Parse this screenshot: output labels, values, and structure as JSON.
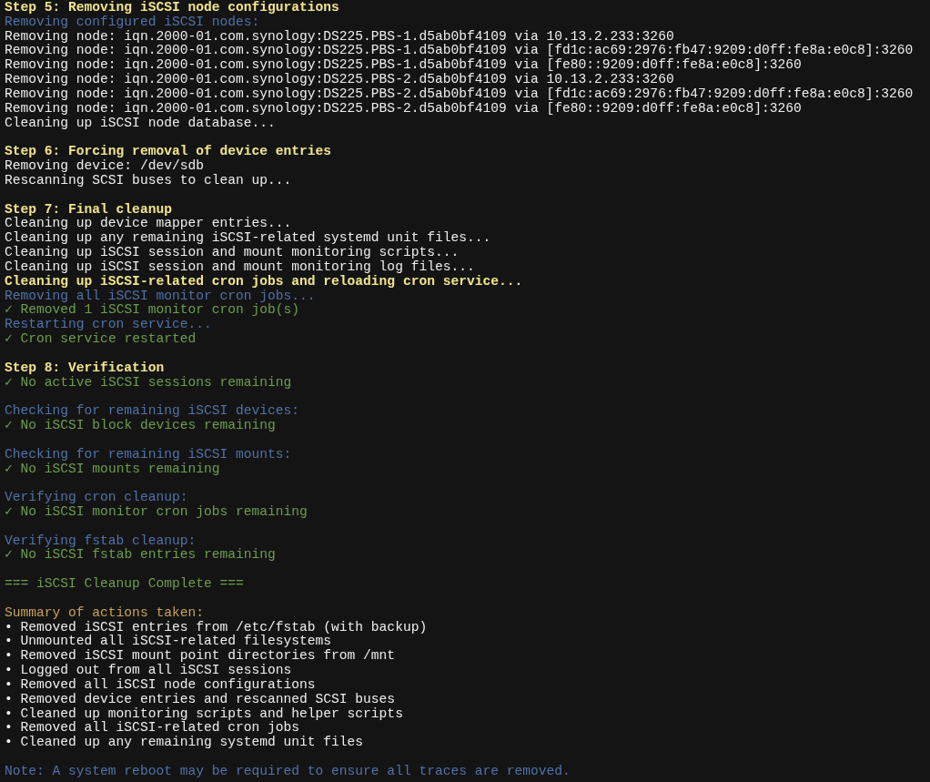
{
  "terminal": {
    "lines": [
      {
        "kind": "heading",
        "text": "Step 5: Removing iSCSI node configurations"
      },
      {
        "kind": "info",
        "text": "Removing configured iSCSI nodes:"
      },
      {
        "kind": "plain",
        "text": "Removing node: iqn.2000-01.com.synology:DS225.PBS-1.d5ab0bf4109 via 10.13.2.233:3260"
      },
      {
        "kind": "plain",
        "text": "Removing node: iqn.2000-01.com.synology:DS225.PBS-1.d5ab0bf4109 via [fd1c:ac69:2976:fb47:9209:d0ff:fe8a:e0c8]:3260"
      },
      {
        "kind": "plain",
        "text": "Removing node: iqn.2000-01.com.synology:DS225.PBS-1.d5ab0bf4109 via [fe80::9209:d0ff:fe8a:e0c8]:3260"
      },
      {
        "kind": "plain",
        "text": "Removing node: iqn.2000-01.com.synology:DS225.PBS-2.d5ab0bf4109 via 10.13.2.233:3260"
      },
      {
        "kind": "plain",
        "text": "Removing node: iqn.2000-01.com.synology:DS225.PBS-2.d5ab0bf4109 via [fd1c:ac69:2976:fb47:9209:d0ff:fe8a:e0c8]:3260"
      },
      {
        "kind": "plain",
        "text": "Removing node: iqn.2000-01.com.synology:DS225.PBS-2.d5ab0bf4109 via [fe80::9209:d0ff:fe8a:e0c8]:3260"
      },
      {
        "kind": "plain",
        "text": "Cleaning up iSCSI node database..."
      },
      {
        "kind": "blank"
      },
      {
        "kind": "heading",
        "text": "Step 6: Forcing removal of device entries"
      },
      {
        "kind": "plain",
        "text": "Removing device: /dev/sdb"
      },
      {
        "kind": "plain",
        "text": "Rescanning SCSI buses to clean up..."
      },
      {
        "kind": "blank"
      },
      {
        "kind": "heading",
        "text": "Step 7: Final cleanup"
      },
      {
        "kind": "plain",
        "text": "Cleaning up device mapper entries..."
      },
      {
        "kind": "plain",
        "text": "Cleaning up any remaining iSCSI-related systemd unit files..."
      },
      {
        "kind": "plain",
        "text": "Cleaning up iSCSI session and mount monitoring scripts..."
      },
      {
        "kind": "plain",
        "text": "Cleaning up iSCSI session and mount monitoring log files..."
      },
      {
        "kind": "heading",
        "text": "Cleaning up iSCSI-related cron jobs and reloading cron service..."
      },
      {
        "kind": "info",
        "text": "Removing all iSCSI monitor cron jobs..."
      },
      {
        "kind": "ok",
        "text": "✓ Removed 1 iSCSI monitor cron job(s)"
      },
      {
        "kind": "info",
        "text": "Restarting cron service..."
      },
      {
        "kind": "ok",
        "text": "✓ Cron service restarted"
      },
      {
        "kind": "blank"
      },
      {
        "kind": "heading",
        "text": "Step 8: Verification"
      },
      {
        "kind": "ok",
        "text": "✓ No active iSCSI sessions remaining"
      },
      {
        "kind": "blank"
      },
      {
        "kind": "info",
        "text": "Checking for remaining iSCSI devices:"
      },
      {
        "kind": "ok",
        "text": "✓ No iSCSI block devices remaining"
      },
      {
        "kind": "blank"
      },
      {
        "kind": "info",
        "text": "Checking for remaining iSCSI mounts:"
      },
      {
        "kind": "ok",
        "text": "✓ No iSCSI mounts remaining"
      },
      {
        "kind": "blank"
      },
      {
        "kind": "info",
        "text": "Verifying cron cleanup:"
      },
      {
        "kind": "ok",
        "text": "✓ No iSCSI monitor cron jobs remaining"
      },
      {
        "kind": "blank"
      },
      {
        "kind": "info",
        "text": "Verifying fstab cleanup:"
      },
      {
        "kind": "ok",
        "text": "✓ No iSCSI fstab entries remaining"
      },
      {
        "kind": "blank"
      },
      {
        "kind": "ok",
        "text": "=== iSCSI Cleanup Complete ==="
      },
      {
        "kind": "blank"
      },
      {
        "kind": "summary",
        "text": "Summary of actions taken:"
      },
      {
        "kind": "plain",
        "text": "• Removed iSCSI entries from /etc/fstab (with backup)"
      },
      {
        "kind": "plain",
        "text": "• Unmounted all iSCSI-related filesystems"
      },
      {
        "kind": "plain",
        "text": "• Removed iSCSI mount point directories from /mnt"
      },
      {
        "kind": "plain",
        "text": "• Logged out from all iSCSI sessions"
      },
      {
        "kind": "plain",
        "text": "• Removed all iSCSI node configurations"
      },
      {
        "kind": "plain",
        "text": "• Removed device entries and rescanned SCSI buses"
      },
      {
        "kind": "plain",
        "text": "• Cleaned up monitoring scripts and helper scripts"
      },
      {
        "kind": "plain",
        "text": "• Removed all iSCSI-related cron jobs"
      },
      {
        "kind": "plain",
        "text": "• Cleaned up any remaining systemd unit files"
      },
      {
        "kind": "blank"
      },
      {
        "kind": "info",
        "text": "Note: A system reboot may be required to ensure all traces are removed."
      }
    ]
  }
}
